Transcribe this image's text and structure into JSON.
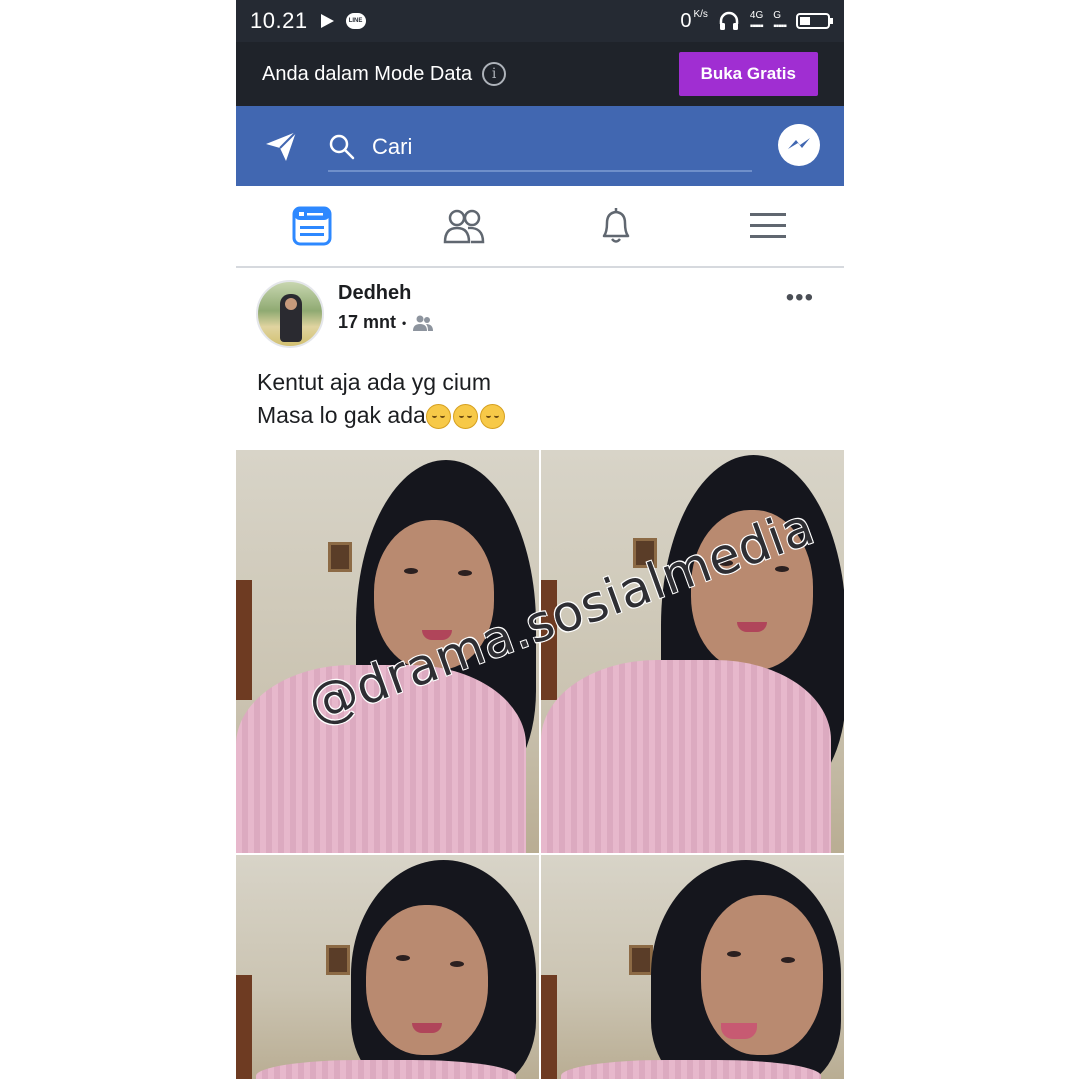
{
  "status_bar": {
    "time": "10.21",
    "net_speed_value": "0",
    "net_speed_unit": "K/s",
    "sim1_label": "4G",
    "sim2_label": "G"
  },
  "data_banner": {
    "text": "Anda dalam Mode Data",
    "info_icon": "i",
    "button_label": "Buka Gratis"
  },
  "header": {
    "search_text": "Cari",
    "left_icon": "paper-plane-icon",
    "right_icon": "messenger-icon"
  },
  "nav_tabs": [
    {
      "name": "news-feed",
      "icon": "news-feed-icon",
      "active": true
    },
    {
      "name": "friends",
      "icon": "friends-icon",
      "active": false
    },
    {
      "name": "notifications",
      "icon": "bell-icon",
      "active": false
    },
    {
      "name": "menu",
      "icon": "hamburger-icon",
      "active": false
    }
  ],
  "post": {
    "author": "Dedheh",
    "time": "17 mnt",
    "audience_icon": "friends-audience-icon",
    "text_line1": "Kentut aja ada yg cium",
    "text_line2": "Masa lo gak ada",
    "emoji_count": 3,
    "photo_count": 4
  },
  "watermark": "@drama.sosialmedia",
  "colors": {
    "status_bar": "#252a33",
    "banner": "#1f232a",
    "buka_button": "#a02ed2",
    "fb_blue": "#4167b1"
  }
}
